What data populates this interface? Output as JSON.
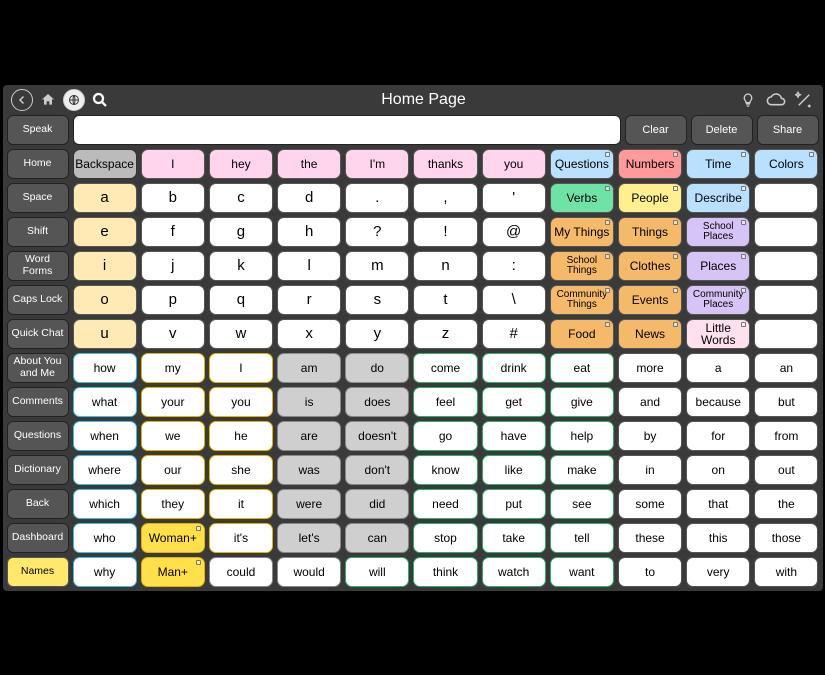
{
  "topbar": {
    "title": "Home Page"
  },
  "msg": {
    "placeholder": ""
  },
  "actions": {
    "clear": "Clear",
    "delete": "Delete",
    "share": "Share"
  },
  "side": [
    "Speak",
    "Home",
    "Space",
    "Shift",
    "Word Forms",
    "Caps Lock",
    "Quick Chat",
    "About You and Me",
    "Comments",
    "Questions",
    "Dictionary",
    "Back",
    "Dashboard",
    "Names"
  ],
  "rows": [
    [
      {
        "t": "Backspace",
        "cls": "c-darkgray b-dark"
      },
      {
        "t": "I",
        "cls": "c-pink"
      },
      {
        "t": "hey",
        "cls": "c-pink"
      },
      {
        "t": "the",
        "cls": "c-pink"
      },
      {
        "t": "I'm",
        "cls": "c-pink"
      },
      {
        "t": "thanks",
        "cls": "c-pink"
      },
      {
        "t": "you",
        "cls": "c-pink"
      },
      {
        "t": "Questions",
        "cls": "c-blue",
        "dog": true
      },
      {
        "t": "Numbers",
        "cls": "c-red",
        "dog": true
      },
      {
        "t": "Time",
        "cls": "c-blue",
        "dog": true
      },
      {
        "t": "Colors",
        "cls": "c-blue",
        "dog": true
      }
    ],
    [
      {
        "t": "a",
        "cls": "c-cream",
        "big": true
      },
      {
        "t": "b",
        "big": true
      },
      {
        "t": "c",
        "big": true
      },
      {
        "t": "d",
        "big": true
      },
      {
        "t": ".",
        "big": true
      },
      {
        "t": ",",
        "big": true
      },
      {
        "t": "'",
        "big": true
      },
      {
        "t": "Verbs",
        "cls": "c-green",
        "dog": true
      },
      {
        "t": "People",
        "cls": "c-yellow",
        "dog": true
      },
      {
        "t": "Describe",
        "cls": "c-blue",
        "dog": true
      },
      {
        "t": "",
        "cls": ""
      }
    ],
    [
      {
        "t": "e",
        "cls": "c-cream",
        "big": true
      },
      {
        "t": "f",
        "big": true
      },
      {
        "t": "g",
        "big": true
      },
      {
        "t": "h",
        "big": true
      },
      {
        "t": "?",
        "big": true
      },
      {
        "t": "!",
        "big": true
      },
      {
        "t": "@",
        "big": true
      },
      {
        "t": "My Things",
        "cls": "c-orange",
        "dog": true
      },
      {
        "t": "Things",
        "cls": "c-orange",
        "dog": true
      },
      {
        "t": "School Places",
        "cls": "c-purple",
        "dog": true
      },
      {
        "t": "",
        "cls": ""
      }
    ],
    [
      {
        "t": "i",
        "cls": "c-cream",
        "big": true
      },
      {
        "t": "j",
        "big": true
      },
      {
        "t": "k",
        "big": true
      },
      {
        "t": "l",
        "big": true
      },
      {
        "t": "m",
        "big": true
      },
      {
        "t": "n",
        "big": true
      },
      {
        "t": ":",
        "big": true
      },
      {
        "t": "School Things",
        "cls": "c-orange",
        "dog": true
      },
      {
        "t": "Clothes",
        "cls": "c-orange",
        "dog": true
      },
      {
        "t": "Places",
        "cls": "c-purple",
        "dog": true
      },
      {
        "t": "",
        "cls": ""
      }
    ],
    [
      {
        "t": "o",
        "cls": "c-cream",
        "big": true
      },
      {
        "t": "p",
        "big": true
      },
      {
        "t": "q",
        "big": true
      },
      {
        "t": "r",
        "big": true
      },
      {
        "t": "s",
        "big": true
      },
      {
        "t": "t",
        "big": true
      },
      {
        "t": "\\",
        "big": true
      },
      {
        "t": "Community Things",
        "cls": "c-orange",
        "dog": true
      },
      {
        "t": "Events",
        "cls": "c-orange",
        "dog": true
      },
      {
        "t": "Community Places",
        "cls": "c-purple",
        "dog": true
      },
      {
        "t": "",
        "cls": ""
      }
    ],
    [
      {
        "t": "u",
        "cls": "c-cream",
        "big": true
      },
      {
        "t": "v",
        "big": true
      },
      {
        "t": "w",
        "big": true
      },
      {
        "t": "x",
        "big": true
      },
      {
        "t": "y",
        "big": true
      },
      {
        "t": "z",
        "big": true
      },
      {
        "t": "#",
        "big": true
      },
      {
        "t": "Food",
        "cls": "c-orange",
        "dog": true
      },
      {
        "t": "News",
        "cls": "c-orange",
        "dog": true
      },
      {
        "t": "Little Words",
        "cls": "c-lpink",
        "dog": true
      },
      {
        "t": "",
        "cls": ""
      }
    ],
    [
      {
        "t": "how",
        "cls": "b-cyan"
      },
      {
        "t": "my",
        "cls": "b-yellow"
      },
      {
        "t": "I",
        "cls": "b-yellow"
      },
      {
        "t": "am",
        "cls": "c-gray b-gray"
      },
      {
        "t": "do",
        "cls": "c-gray b-gray"
      },
      {
        "t": "come",
        "cls": "b-green"
      },
      {
        "t": "drink",
        "cls": "b-green"
      },
      {
        "t": "eat",
        "cls": "b-green"
      },
      {
        "t": "more"
      },
      {
        "t": "a"
      },
      {
        "t": "an"
      }
    ],
    [
      {
        "t": "what",
        "cls": "b-cyan"
      },
      {
        "t": "your",
        "cls": "b-yellow"
      },
      {
        "t": "you",
        "cls": "b-yellow"
      },
      {
        "t": "is",
        "cls": "c-gray b-gray"
      },
      {
        "t": "does",
        "cls": "c-gray b-gray"
      },
      {
        "t": "feel",
        "cls": "b-green"
      },
      {
        "t": "get",
        "cls": "b-green"
      },
      {
        "t": "give",
        "cls": "b-green"
      },
      {
        "t": "and"
      },
      {
        "t": "because"
      },
      {
        "t": "but"
      }
    ],
    [
      {
        "t": "when",
        "cls": "b-cyan"
      },
      {
        "t": "we",
        "cls": "b-yellow"
      },
      {
        "t": "he",
        "cls": "b-yellow"
      },
      {
        "t": "are",
        "cls": "c-gray b-gray"
      },
      {
        "t": "doesn't",
        "cls": "c-gray b-gray"
      },
      {
        "t": "go",
        "cls": "b-green"
      },
      {
        "t": "have",
        "cls": "b-green"
      },
      {
        "t": "help",
        "cls": "b-green"
      },
      {
        "t": "by"
      },
      {
        "t": "for"
      },
      {
        "t": "from"
      }
    ],
    [
      {
        "t": "where",
        "cls": "b-cyan"
      },
      {
        "t": "our",
        "cls": "b-yellow"
      },
      {
        "t": "she",
        "cls": "b-yellow"
      },
      {
        "t": "was",
        "cls": "c-gray b-gray"
      },
      {
        "t": "don't",
        "cls": "c-gray b-gray"
      },
      {
        "t": "know",
        "cls": "b-green"
      },
      {
        "t": "like",
        "cls": "b-green"
      },
      {
        "t": "make",
        "cls": "b-green"
      },
      {
        "t": "in"
      },
      {
        "t": "on"
      },
      {
        "t": "out"
      }
    ],
    [
      {
        "t": "which",
        "cls": "b-cyan"
      },
      {
        "t": "they",
        "cls": "b-yellow"
      },
      {
        "t": "it",
        "cls": "b-yellow"
      },
      {
        "t": "were",
        "cls": "c-gray b-gray"
      },
      {
        "t": "did",
        "cls": "c-gray b-gray"
      },
      {
        "t": "need",
        "cls": "b-green"
      },
      {
        "t": "put",
        "cls": "b-green"
      },
      {
        "t": "see",
        "cls": "b-green"
      },
      {
        "t": "some"
      },
      {
        "t": "that"
      },
      {
        "t": "the"
      }
    ],
    [
      {
        "t": "who",
        "cls": "b-cyan"
      },
      {
        "t": "Woman+",
        "cls": "c-yelldeep b-yellow",
        "dog": true
      },
      {
        "t": "it's",
        "cls": "b-yellow"
      },
      {
        "t": "let's",
        "cls": "c-gray b-gray"
      },
      {
        "t": "can",
        "cls": "c-gray b-gray"
      },
      {
        "t": "stop",
        "cls": "b-green"
      },
      {
        "t": "take",
        "cls": "b-green"
      },
      {
        "t": "tell",
        "cls": "b-green"
      },
      {
        "t": "these"
      },
      {
        "t": "this"
      },
      {
        "t": "those"
      }
    ],
    [
      {
        "t": "why",
        "cls": "b-cyan"
      },
      {
        "t": "Man+",
        "cls": "c-yelldeep b-yellow",
        "dog": true
      },
      {
        "t": "could",
        "cls": "b-gray"
      },
      {
        "t": "would",
        "cls": "b-gray"
      },
      {
        "t": "will",
        "cls": "b-green"
      },
      {
        "t": "think",
        "cls": "b-green"
      },
      {
        "t": "watch",
        "cls": "b-green"
      },
      {
        "t": "want",
        "cls": "b-green"
      },
      {
        "t": "to"
      },
      {
        "t": "very"
      },
      {
        "t": "with"
      }
    ]
  ]
}
